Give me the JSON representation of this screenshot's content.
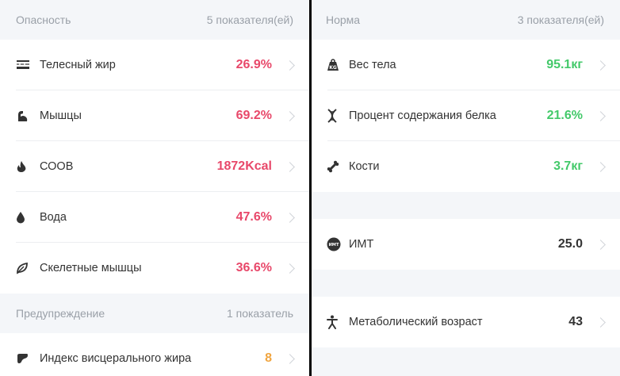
{
  "left": {
    "danger": {
      "title": "Опасность",
      "count": "5 показателя(ей)"
    },
    "danger_items": [
      {
        "label": "Телесный жир",
        "value": "26.9%",
        "icon": "body-fat-icon"
      },
      {
        "label": "Мышцы",
        "value": "69.2%",
        "icon": "muscle-arm-icon"
      },
      {
        "label": "СООВ",
        "value": "1872Kcal",
        "icon": "flame-icon"
      },
      {
        "label": "Вода",
        "value": "47.6%",
        "icon": "water-drop-icon"
      },
      {
        "label": "Скелетные мышцы",
        "value": "36.6%",
        "icon": "leaf-icon"
      }
    ],
    "warning": {
      "title": "Предупреждение",
      "count": "1 показатель"
    },
    "warning_items": [
      {
        "label": "Индекс висцерального жира",
        "value": "8",
        "icon": "organ-icon"
      }
    ]
  },
  "right": {
    "normal": {
      "title": "Норма",
      "count": "3 показателя(ей)"
    },
    "normal_items": [
      {
        "label": "Вес тела",
        "value": "95.1кг",
        "icon": "weight-kg-icon"
      },
      {
        "label": "Процент содержания белка",
        "value": "21.6%",
        "icon": "dna-icon"
      },
      {
        "label": "Кости",
        "value": "3.7кг",
        "icon": "bone-icon"
      }
    ],
    "bmi": {
      "label": "ИМТ",
      "value": "25.0",
      "icon": "bmi-icon",
      "icon_text": "ИМТ"
    },
    "metabolic": {
      "label": "Метаболический возраст",
      "value": "43",
      "icon": "person-icon"
    }
  },
  "colors": {
    "danger": "#e8486a",
    "normal": "#43c96a",
    "warning": "#f0a540"
  }
}
